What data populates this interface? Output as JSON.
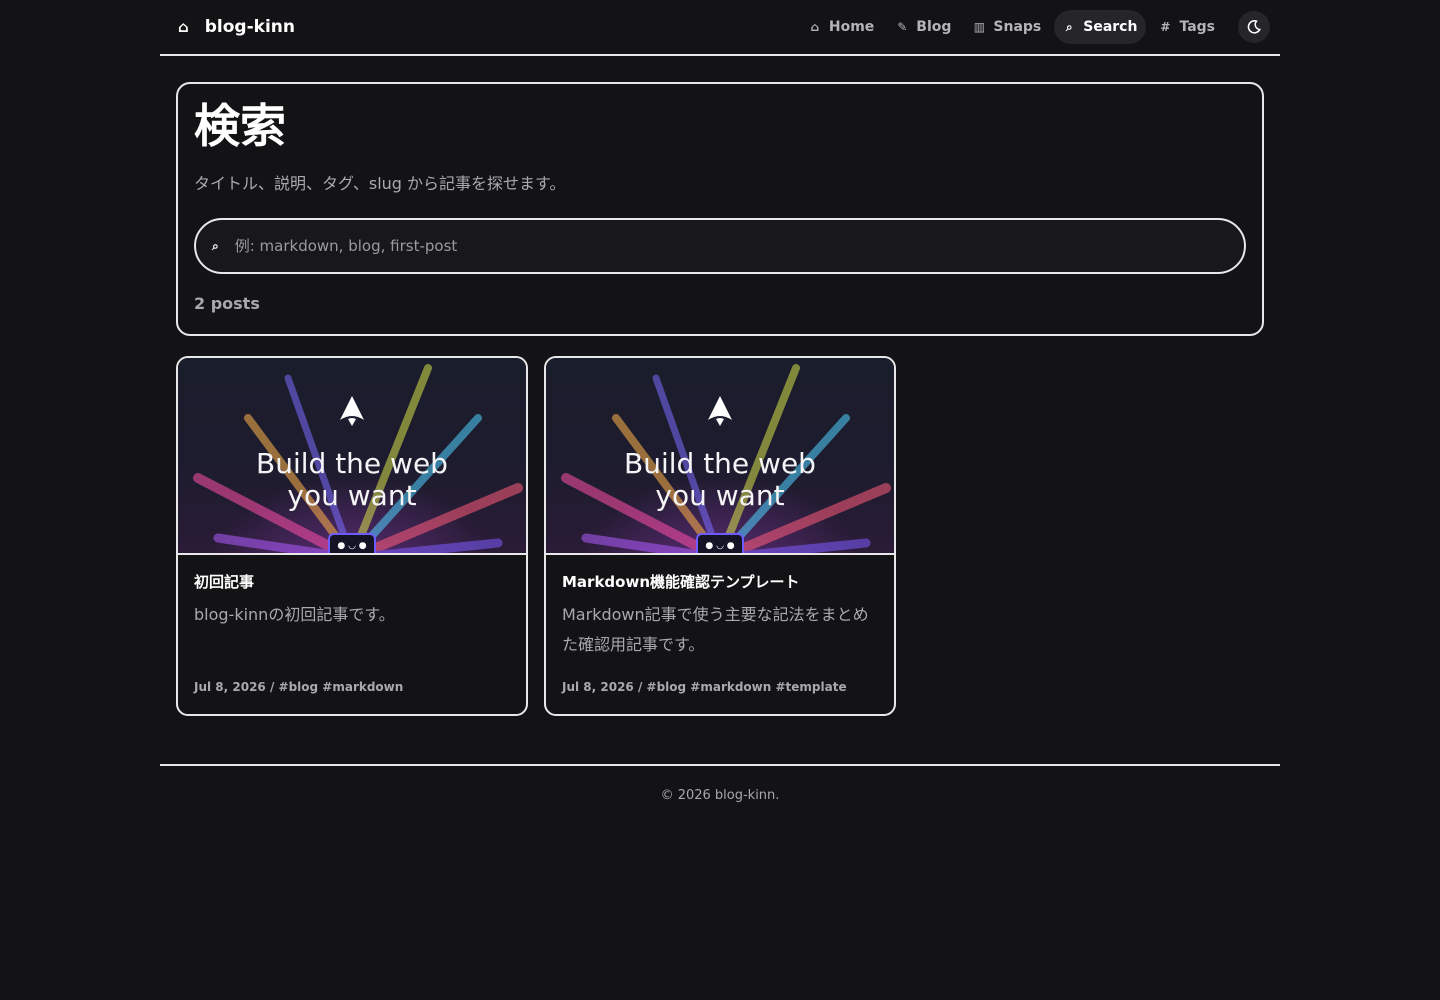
{
  "header": {
    "brand_icon": "home-icon",
    "brand": "blog-kinn",
    "nav": [
      {
        "label": "Home",
        "icon": "home-icon",
        "glyph": "⌂"
      },
      {
        "label": "Blog",
        "icon": "pen-icon",
        "glyph": "✎"
      },
      {
        "label": "Snaps",
        "icon": "columns-icon",
        "glyph": "▥"
      },
      {
        "label": "Search",
        "icon": "search-icon",
        "glyph": "⌕",
        "active": true
      },
      {
        "label": "Tags",
        "icon": "hash-icon",
        "glyph": "#"
      }
    ],
    "theme_toggle_icon": "moon-icon"
  },
  "search": {
    "title": "検索",
    "description": "タイトル、説明、タグ、slug から記事を探せます。",
    "placeholder": "例: markdown, blog, first-post",
    "value": "",
    "count_label": "2 posts"
  },
  "posts": [
    {
      "thumb_line1": "Build the web",
      "thumb_line2": "you want",
      "title": "初回記事",
      "description": "blog-kinnの初回記事です。",
      "meta": "Jul 8, 2026 / #blog #markdown"
    },
    {
      "thumb_line1": "Build the web",
      "thumb_line2": "you want",
      "title": "Markdown機能確認テンプレート",
      "description": "Markdown記事で使う主要な記法をまとめた確認用記事です。",
      "meta": "Jul 8, 2026 / #blog #markdown #template"
    }
  ],
  "footer": {
    "copyright": "© 2026 blog-kinn."
  },
  "colors": {
    "background": "#131315",
    "border": "#e8e8ea",
    "muted_text": "#a8a8ae",
    "active_nav_bg": "#26262a"
  }
}
